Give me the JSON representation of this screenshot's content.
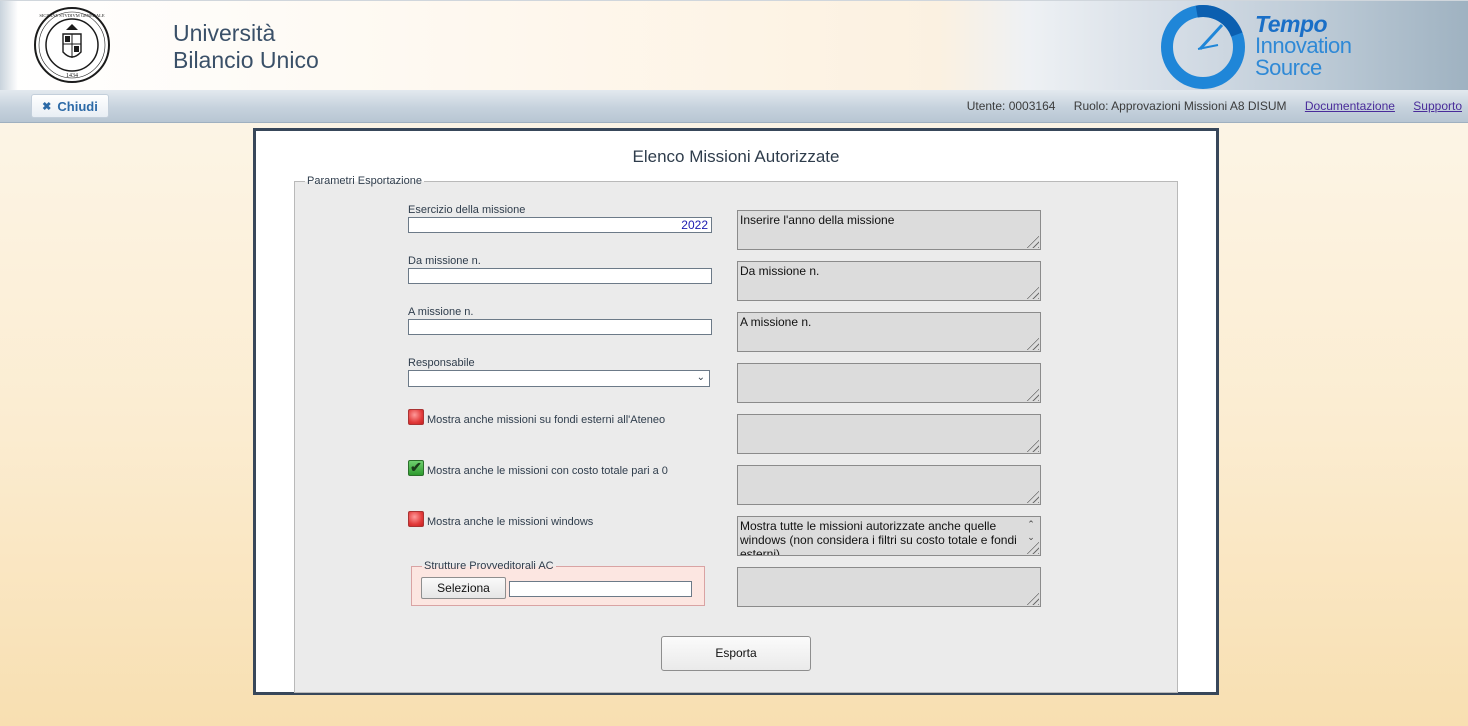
{
  "header": {
    "title_line1": "Università",
    "title_line2": "Bilancio Unico",
    "seal_text_top": "SICILIAE STVDIVM GENERALE",
    "seal_year": "1434",
    "logo_tempo": "Tempo",
    "logo_innovation": "Innovation",
    "logo_source": "Source"
  },
  "toolbar": {
    "close_label": "Chiudi",
    "user": "Utente: 0003164",
    "role": "Ruolo: Approvazioni Missioni A8 DISUM",
    "doc_link": "Documentazione",
    "support_link": "Supporto"
  },
  "form": {
    "title": "Elenco Missioni Autorizzate",
    "legend": "Parametri Esportazione",
    "esercizio": {
      "label": "Esercizio della missione",
      "value": "2022",
      "note": "Inserire l'anno della missione"
    },
    "da_missione": {
      "label": "Da missione n.",
      "value": "",
      "note": "Da missione n."
    },
    "a_missione": {
      "label": "A missione n.",
      "value": "",
      "note": "A missione n."
    },
    "responsabile": {
      "label": "Responsabile",
      "value": "",
      "note": ""
    },
    "chk_fondi_esterni": {
      "label": "Mostra anche missioni su fondi esterni all'Ateneo",
      "checked": false,
      "note": ""
    },
    "chk_costo_zero": {
      "label": "Mostra anche le missioni con costo totale pari a 0",
      "checked": true,
      "mark": "✔",
      "note": ""
    },
    "chk_windows": {
      "label": "Mostra anche le missioni windows",
      "checked": false,
      "note": "Mostra tutte le missioni autorizzate anche quelle windows (non considera i filtri su costo totale e fondi esterni)"
    },
    "strutture": {
      "legend": "Strutture Provveditorali AC",
      "button": "Seleziona",
      "value": "",
      "note": ""
    },
    "export_label": "Esporta"
  },
  "colors": {
    "panel_border": "#38475a",
    "checkbox_off": "#e23b3b",
    "checkbox_on": "#2e9a2e",
    "link": "#4a2c9a",
    "accent": "#2c6aa7"
  }
}
